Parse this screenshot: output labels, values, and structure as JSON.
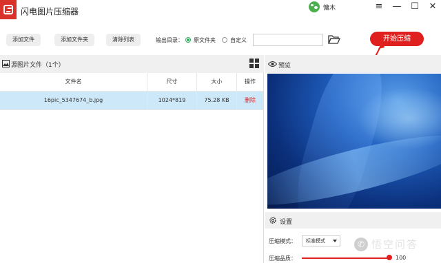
{
  "app": {
    "title": "闪电图片压缩器",
    "username": "慵木"
  },
  "window": {
    "menu_glyph": "≡",
    "minimize_glyph": "—",
    "maximize_glyph": "☐",
    "close_glyph": "✕"
  },
  "toolbar": {
    "add_file": "添加文件",
    "add_folder": "添加文件夹",
    "clear_list": "清除列表",
    "output_dir_label": "输出目录：",
    "radio_original": "原文件夹",
    "radio_custom": "自定义",
    "path_value": "",
    "start_button": "开始压缩"
  },
  "source_panel": {
    "title": "源图片文件（1个）",
    "columns": [
      "文件名",
      "尺寸",
      "大小",
      "操作"
    ],
    "rows": [
      {
        "filename": "16pic_5347674_b.jpg",
        "dimensions": "1024*819",
        "size": "75.28 KB",
        "action": "删除"
      }
    ]
  },
  "preview_panel": {
    "title": "预览"
  },
  "settings": {
    "title": "设置",
    "mode_label": "压缩模式：",
    "mode_value": "标准模式",
    "quality_label": "压缩品质：",
    "quality_value": "100"
  },
  "watermark": {
    "text": "悟空问答"
  },
  "colors": {
    "accent": "#e0201f",
    "radio_selected": "#2ab05a",
    "row_selected": "#cde8f8"
  }
}
